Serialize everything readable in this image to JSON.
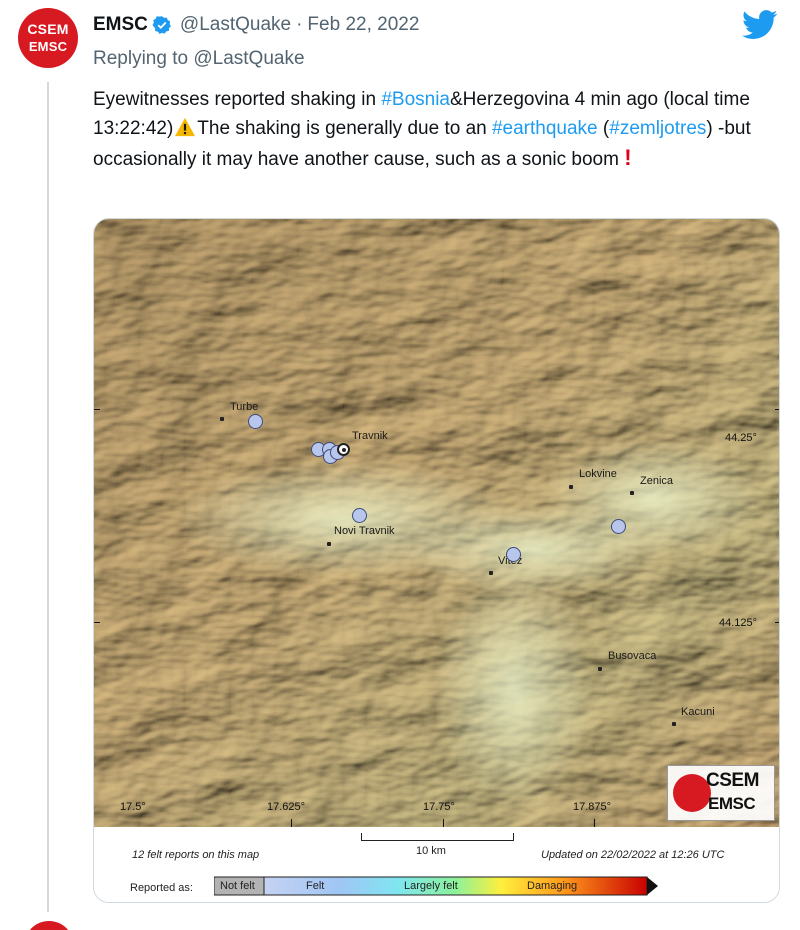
{
  "tweet": {
    "avatar_line1": "CSEM",
    "avatar_line2": "EMSC",
    "name": "EMSC",
    "handle": "@LastQuake",
    "separator": "·",
    "date": "Feb 22, 2022",
    "replying_prefix": "Replying to",
    "replying_handle": "@LastQuake",
    "text": {
      "p1": "Eyewitnesses reported shaking in ",
      "hashtag1": "#Bosnia",
      "p2": "&Herzegovina 4 min ago (local time 13:22:42)",
      "p3": "The shaking is generally due to an ",
      "hashtag2": "#earthquake",
      "p4": " (",
      "hashtag3": "#zemljotres",
      "p5": ") -but occasionally it may have another cause, such as a sonic boom "
    },
    "icons": [
      "verified-badge-icon",
      "twitter-bird-icon",
      "warning-icon",
      "exclamation-icon"
    ],
    "colors": {
      "link": "#1d9bf0",
      "brand": "#d71921",
      "muted": "#536471"
    }
  },
  "map": {
    "towns": [
      {
        "name": "Turbe"
      },
      {
        "name": "Travnik"
      },
      {
        "name": "Novi Travnik"
      },
      {
        "name": "Lokvine"
      },
      {
        "name": "Zenica"
      },
      {
        "name": "Vitez"
      },
      {
        "name": "Busovaca"
      },
      {
        "name": "Kacuni"
      }
    ],
    "lat_labels": [
      "44.25°",
      "44.125°"
    ],
    "lon_labels": [
      "17.5°",
      "17.625°",
      "17.75°",
      "17.875°"
    ],
    "logo_line1": "CSEM",
    "logo_line2": "EMSC",
    "scale_label": "10 km",
    "reports_count": "12 felt reports on this map",
    "updated": "Updated on 22/02/2022 at 12:26 UTC",
    "legend_title": "Reported as:",
    "legend": [
      "Not felt",
      "Felt",
      "Largely felt",
      "Damaging"
    ],
    "report_color": "#b8c6ec"
  }
}
